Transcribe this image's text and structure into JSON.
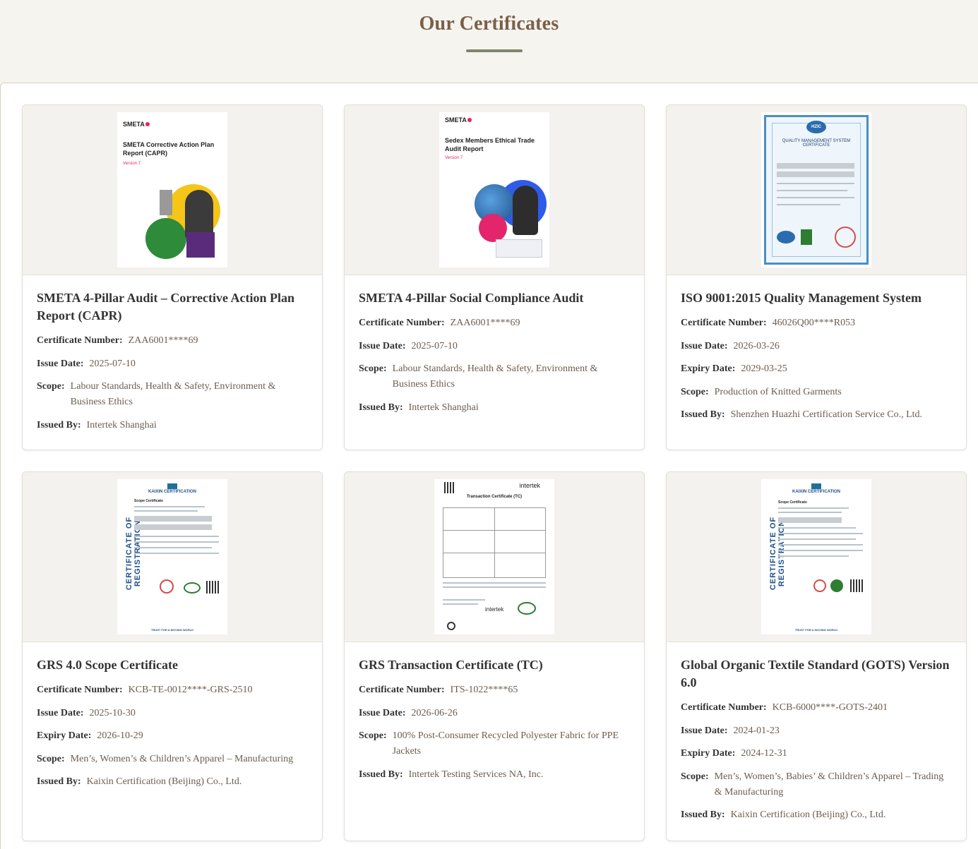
{
  "page": {
    "title": "Our Certificates"
  },
  "thumbnails": {
    "smeta_capr": {
      "logo": "SMETA",
      "title": "SMETA Corrective Action Plan Report (CAPR)",
      "version": "Version 7"
    },
    "smeta_audit": {
      "logo": "SMETA",
      "title": "Sedex Members Ethical Trade Audit Report",
      "version": "Version 7"
    },
    "iso": {
      "badge": "HZIC",
      "title": "QUALITY MANAGEMENT SYSTEM CERTIFICATE"
    },
    "grs_scope": {
      "side": "CERTIFICATE OF REGISTRATION",
      "logo": "KAIXIN CERTIFICATION",
      "heading": "Scope Certificate",
      "footer": "TRUST FOR A MOVING WORLD"
    },
    "grs_tc": {
      "logo": "intertek",
      "heading": "Transaction Certificate (TC)"
    },
    "gots": {
      "side": "CERTIFICATE OF REGISTRATION",
      "logo": "KAIXIN CERTIFICATION",
      "heading": "Scope Certificate",
      "footer": "TRUST FOR A MOVING WORLD"
    }
  },
  "labels": {
    "cert_number": "Certificate Number:",
    "issue_date": "Issue Date:",
    "expiry_date": "Expiry Date:",
    "scope": "Scope:",
    "issued_by": "Issued By:"
  },
  "certificates": [
    {
      "title": "SMETA 4-Pillar Audit – Corrective Action Plan Report (CAPR)",
      "cert_number": "ZAA6001****69",
      "issue_date": "2025-07-10",
      "scope": "Labour Standards, Health & Safety, Environment & Business Ethics",
      "issued_by": "Intertek Shanghai"
    },
    {
      "title": "SMETA 4-Pillar Social Compliance Audit",
      "cert_number": "ZAA6001****69",
      "issue_date": "2025-07-10",
      "scope": "Labour Standards, Health & Safety, Environment & Business Ethics",
      "issued_by": "Intertek Shanghai"
    },
    {
      "title": "ISO 9001:2015 Quality Management System",
      "cert_number": "46026Q00****R053",
      "issue_date": "2026-03-26",
      "expiry_date": "2029-03-25",
      "scope": "Production of Knitted Garments",
      "issued_by": "Shenzhen Huazhi Certification Service Co., Ltd."
    },
    {
      "title": "GRS 4.0 Scope Certificate",
      "cert_number": "KCB-TE-0012****-GRS-2510",
      "issue_date": "2025-10-30",
      "expiry_date": "2026-10-29",
      "scope": "Men’s, Women’s & Children’s Apparel – Manufacturing",
      "issued_by": "Kaixin Certification (Beijing) Co., Ltd."
    },
    {
      "title": "GRS Transaction Certificate (TC)",
      "cert_number": "ITS-1022****65",
      "issue_date": "2026-06-26",
      "scope": "100% Post-Consumer Recycled Polyester Fabric for PPE Jackets",
      "issued_by": "Intertek Testing Services NA, Inc."
    },
    {
      "title": "Global Organic Textile Standard (GOTS) Version 6.0",
      "cert_number": "KCB-6000****-GOTS-2401",
      "issue_date": "2024-01-23",
      "expiry_date": "2024-12-31",
      "scope": "Men’s, Women’s, Babies’ & Children’s Apparel – Trading & Manufacturing",
      "issued_by": "Kaixin Certification (Beijing) Co., Ltd."
    }
  ]
}
